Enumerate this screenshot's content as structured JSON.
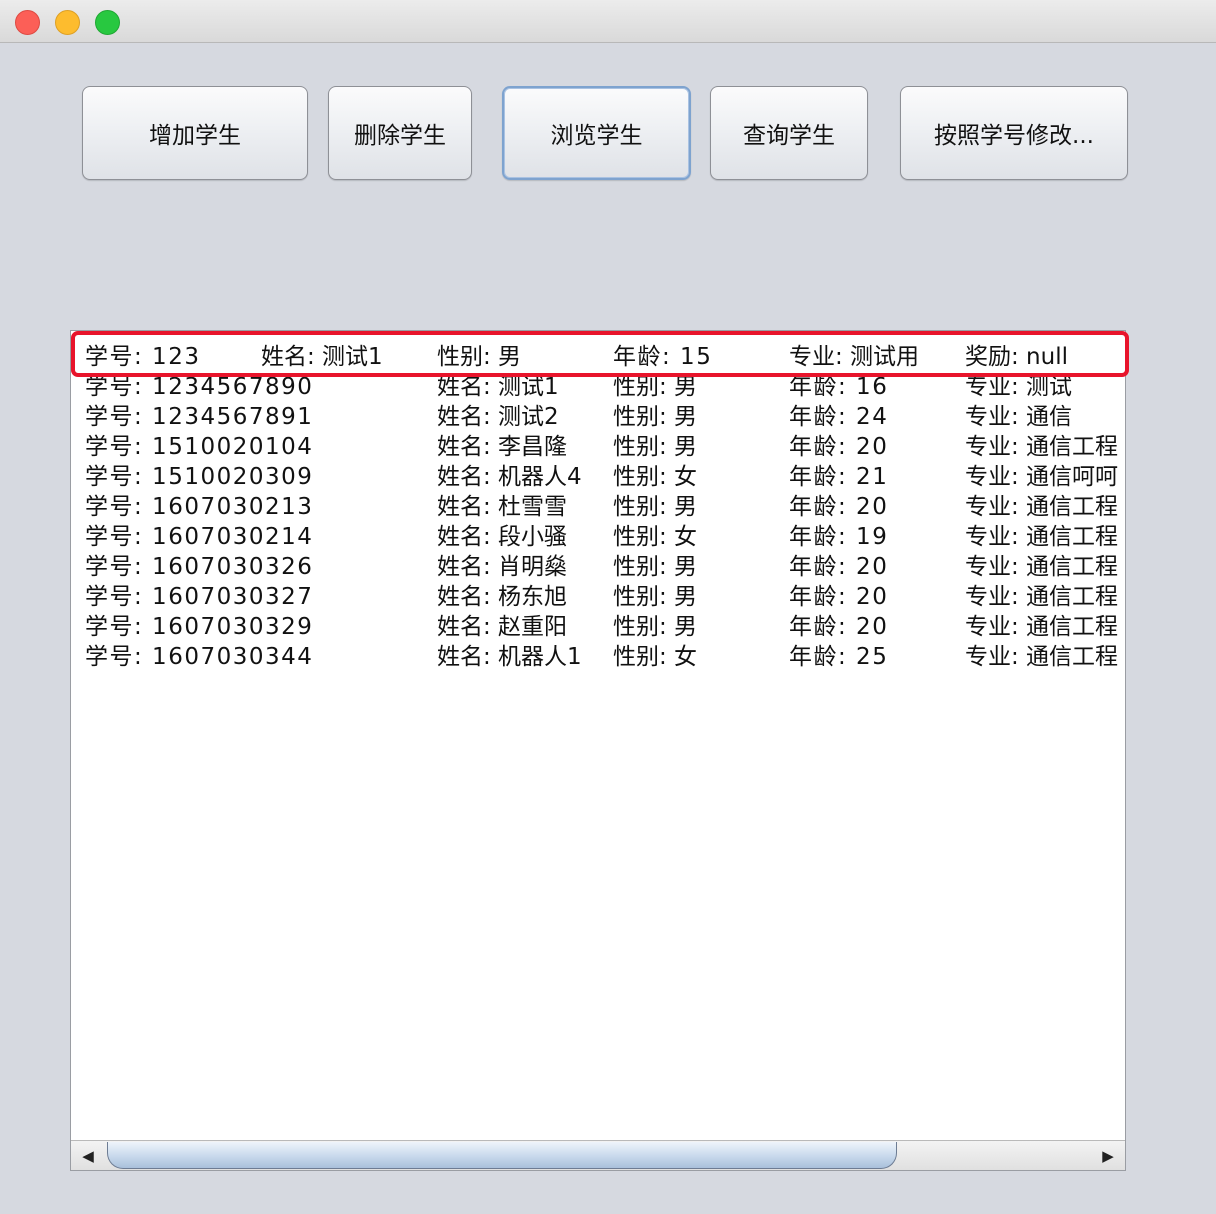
{
  "window": {
    "controls": {
      "close_icon": "close-icon",
      "minimize_icon": "minimize-icon",
      "maximize_icon": "maximize-icon"
    }
  },
  "toolbar": {
    "add_label": "增加学生",
    "delete_label": "删除学生",
    "browse_label": "浏览学生",
    "query_label": "查询学生",
    "modify_label": "按照学号修改..."
  },
  "students": [
    {
      "id": "学号: 123",
      "name": "姓名: 测试1",
      "gender": "性别: 男",
      "age": "年龄: 15",
      "major": "专业: 测试用",
      "award": "奖励: null"
    },
    {
      "id": "学号: 1234567890",
      "name": "姓名: 测试1",
      "gender": "性别: 男",
      "age": "年龄: 16",
      "major": "专业: 测试",
      "award": ""
    },
    {
      "id": "学号: 1234567891",
      "name": "姓名: 测试2",
      "gender": "性别: 男",
      "age": "年龄: 24",
      "major": "专业: 通信",
      "award": ""
    },
    {
      "id": "学号: 1510020104",
      "name": "姓名: 李昌隆",
      "gender": "性别: 男",
      "age": "年龄: 20",
      "major": "专业: 通信工程",
      "award": ""
    },
    {
      "id": "学号: 1510020309",
      "name": "姓名: 机器人4",
      "gender": "性别: 女",
      "age": "年龄: 21",
      "major": "专业: 通信呵呵",
      "award": ""
    },
    {
      "id": "学号: 1607030213",
      "name": "姓名: 杜雪雪",
      "gender": "性别: 男",
      "age": "年龄: 20",
      "major": "专业: 通信工程",
      "award": ""
    },
    {
      "id": "学号: 1607030214",
      "name": "姓名: 段小骚",
      "gender": "性别: 女",
      "age": "年龄: 19",
      "major": "专业: 通信工程",
      "award": ""
    },
    {
      "id": "学号: 1607030326",
      "name": "姓名: 肖明燊",
      "gender": "性别: 男",
      "age": "年龄: 20",
      "major": "专业: 通信工程",
      "award": ""
    },
    {
      "id": "学号: 1607030327",
      "name": "姓名: 杨东旭",
      "gender": "性别: 男",
      "age": "年龄: 20",
      "major": "专业: 通信工程",
      "award": ""
    },
    {
      "id": "学号: 1607030329",
      "name": "姓名: 赵重阳",
      "gender": "性别: 男",
      "age": "年龄: 20",
      "major": "专业: 通信工程",
      "award": ""
    },
    {
      "id": "学号: 1607030344",
      "name": "姓名: 机器人1",
      "gender": "性别: 女",
      "age": "年龄: 25",
      "major": "专业: 通信工程",
      "award": ""
    }
  ],
  "scrollbar": {
    "left_arrow": "◀",
    "right_arrow": "▶"
  },
  "colors": {
    "highlight": "#e8142b",
    "focus_ring": "#7ea3cf",
    "window_bg": "#d6d9e0"
  }
}
